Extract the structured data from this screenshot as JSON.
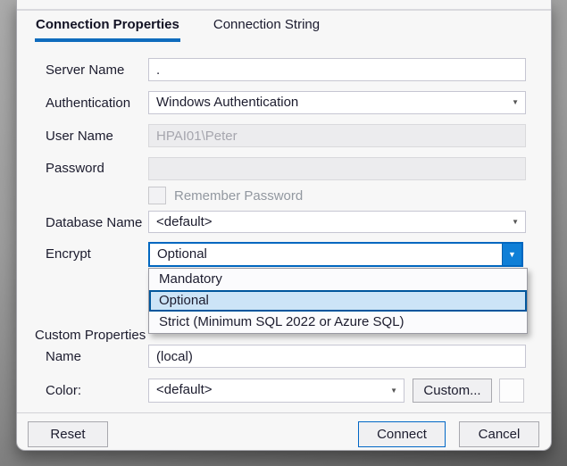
{
  "tabs": [
    {
      "label": "Connection Properties",
      "active": true
    },
    {
      "label": "Connection String",
      "active": false
    }
  ],
  "fields": {
    "server_name": {
      "label": "Server Name",
      "value": "."
    },
    "authentication": {
      "label": "Authentication",
      "value": "Windows Authentication"
    },
    "user_name": {
      "label": "User Name",
      "value": "HPAI01\\Peter",
      "disabled": true
    },
    "password": {
      "label": "Password",
      "value": "",
      "disabled": true
    },
    "remember_password": {
      "label": "Remember Password",
      "checked": false
    },
    "database_name": {
      "label": "Database Name",
      "value": "<default>"
    },
    "encrypt": {
      "label": "Encrypt",
      "value": "Optional",
      "options": [
        "Mandatory",
        "Optional",
        "Strict (Minimum SQL 2022 or Azure SQL)"
      ],
      "selected_option": "Optional",
      "open": true
    }
  },
  "custom_properties": {
    "section_label": "Custom Properties",
    "name": {
      "label": "Name",
      "value": "(local)"
    },
    "color": {
      "label": "Color:",
      "value": "<default>",
      "custom_button": "Custom..."
    }
  },
  "buttons": {
    "reset": "Reset",
    "connect": "Connect",
    "cancel": "Cancel"
  },
  "icons": {
    "dropdown_arrow": "▼"
  },
  "colors": {
    "accent_tab_underline": "#0f6cbd",
    "focused_combo_border": "#0067c0",
    "dropdown_button_blue": "#0f7fd7",
    "highlight_option_bg": "#cce4f7",
    "highlight_option_border": "#00569c",
    "connect_button_border": "#0067c6",
    "dialog_background": "#f7f7f7"
  }
}
